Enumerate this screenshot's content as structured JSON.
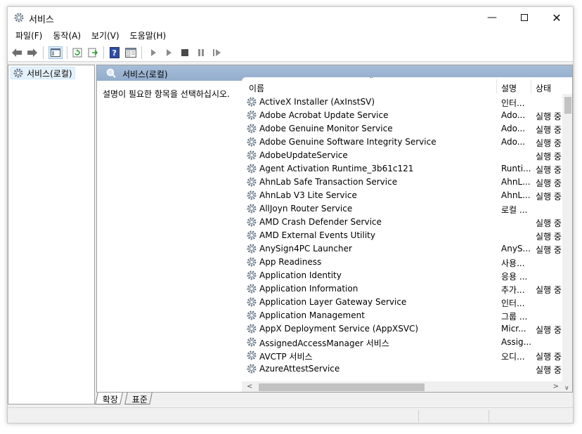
{
  "window": {
    "title": "서비스",
    "minimize_icon": "minimize-icon",
    "maximize_icon": "maximize-icon",
    "close_icon": "close-icon"
  },
  "menu": [
    "파일(F)",
    "동작(A)",
    "보기(V)",
    "도움말(H)"
  ],
  "toolbar": {
    "icons": [
      "back-arrow-icon",
      "forward-arrow-icon",
      "show-hide-console-tree-icon",
      "refresh-icon",
      "export-list-icon",
      "help-icon",
      "properties-icon",
      "start-service-icon",
      "start-service-alt-icon",
      "stop-service-icon",
      "pause-service-icon",
      "restart-service-icon"
    ]
  },
  "tree": {
    "root_label": "서비스(로컬)"
  },
  "pane": {
    "title": "서비스(로컬)",
    "description_prompt": "설명이 필요한 항목을 선택하십시오."
  },
  "list": {
    "columns": {
      "name": "이름",
      "description": "설명",
      "status": "상태"
    },
    "rows": [
      {
        "name": "ActiveX Installer (AxInstSV)",
        "description": "인터...",
        "status": ""
      },
      {
        "name": "Adobe Acrobat Update Service",
        "description": "Ado...",
        "status": "실행 중"
      },
      {
        "name": "Adobe Genuine Monitor Service",
        "description": "Ado...",
        "status": "실행 중"
      },
      {
        "name": "Adobe Genuine Software Integrity Service",
        "description": "Ado...",
        "status": "실행 중"
      },
      {
        "name": "AdobeUpdateService",
        "description": "",
        "status": "실행 중"
      },
      {
        "name": "Agent Activation Runtime_3b61c121",
        "description": "Runti...",
        "status": "실행 중"
      },
      {
        "name": "AhnLab Safe Transaction Service",
        "description": "AhnL...",
        "status": "실행 중"
      },
      {
        "name": "AhnLab V3 Lite Service",
        "description": "AhnL...",
        "status": "실행 중"
      },
      {
        "name": "AllJoyn Router Service",
        "description": "로컬 ...",
        "status": ""
      },
      {
        "name": "AMD Crash Defender Service",
        "description": "",
        "status": "실행 중"
      },
      {
        "name": "AMD External Events Utility",
        "description": "",
        "status": "실행 중"
      },
      {
        "name": "AnySign4PC Launcher",
        "description": "AnyS...",
        "status": "실행 중"
      },
      {
        "name": "App Readiness",
        "description": "사용...",
        "status": ""
      },
      {
        "name": "Application Identity",
        "description": "응용 ...",
        "status": ""
      },
      {
        "name": "Application Information",
        "description": "추가...",
        "status": "실행 중"
      },
      {
        "name": "Application Layer Gateway Service",
        "description": "인터...",
        "status": ""
      },
      {
        "name": "Application Management",
        "description": "그룹 ...",
        "status": ""
      },
      {
        "name": "AppX Deployment Service (AppXSVC)",
        "description": "Micr...",
        "status": "실행 중"
      },
      {
        "name": "AssignedAccessManager 서비스",
        "description": "Assig...",
        "status": ""
      },
      {
        "name": "AVCTP 서비스",
        "description": "오디...",
        "status": "실행 중"
      },
      {
        "name": "AzureAttestService",
        "description": "",
        "status": "실행 중"
      }
    ]
  },
  "tabs": {
    "extended": "확장",
    "standard": "표준"
  }
}
